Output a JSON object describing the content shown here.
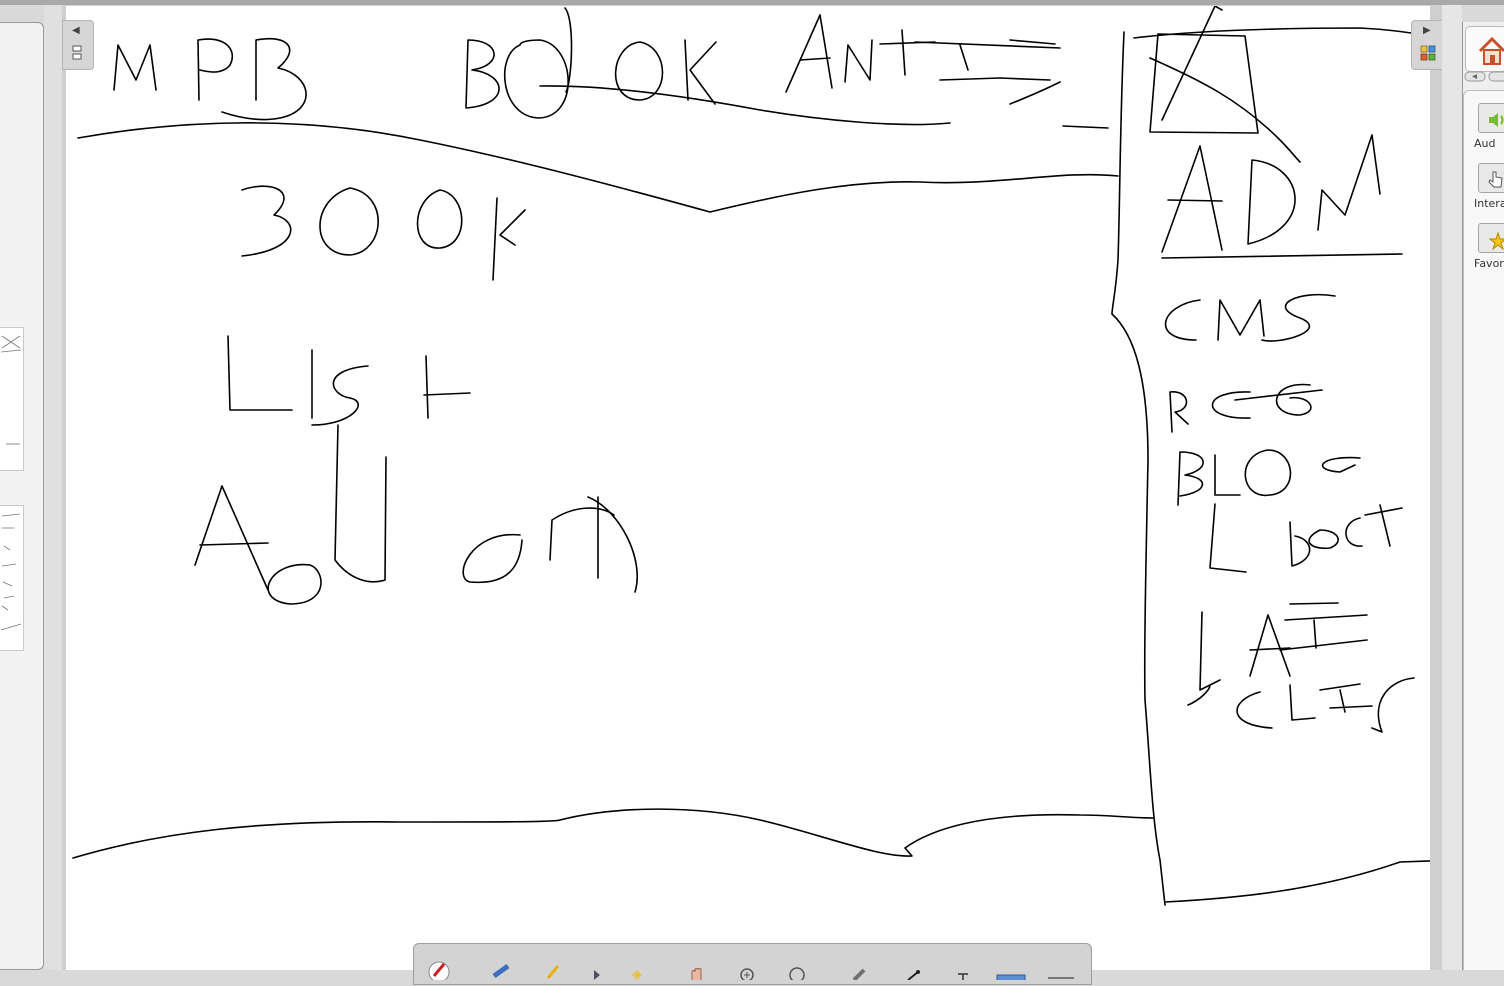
{
  "window": {
    "title": "",
    "colors": {
      "canvas": "#ffffff",
      "chrome": "#d9d9d9",
      "ink": "#000000",
      "home_roof": "#c8502a"
    }
  },
  "sidebar_left": {
    "name": "page-sorter",
    "thumbnails": [
      {
        "label": "page-thumbnail-1"
      },
      {
        "label": "page-thumbnail-2"
      }
    ]
  },
  "canvas": {
    "handwritten_text": [
      "MPB",
      "BOOK",
      "ARTICLES",
      "BOOK",
      "List",
      "Add on",
      "ADM",
      "CMS",
      "REG",
      "BLOG",
      "L BOOK",
      "L ARTICLES"
    ]
  },
  "gallery": {
    "items": [
      {
        "label": "Aud",
        "icon": "audio-folder-icon"
      },
      {
        "label": "Intera",
        "icon": "interactive-folder-icon"
      },
      {
        "label": "Favor",
        "icon": "favorites-folder-icon"
      }
    ]
  },
  "toolbar": {
    "tools": [
      "pen-red-icon",
      "pen-blue-icon",
      "highlighter-icon",
      "pointer-icon",
      "magic-pen-icon",
      "hand-icon",
      "zoom-in-icon",
      "search-icon",
      "eraser-icon",
      "line-icon",
      "text-icon",
      "screen-shade-icon",
      "more-icon"
    ]
  }
}
